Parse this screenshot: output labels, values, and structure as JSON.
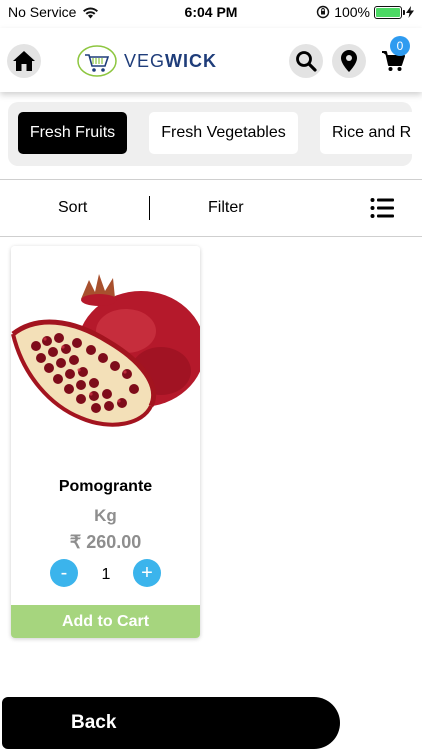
{
  "status_bar": {
    "carrier": "No Service",
    "time": "6:04 PM",
    "battery": "100%"
  },
  "header": {
    "logo_text_part1": "VEG",
    "logo_text_part2": "WICK",
    "cart_count": "0",
    "icons": [
      "home-icon",
      "search-icon",
      "location-icon",
      "cart-icon"
    ]
  },
  "categories": [
    {
      "label": "Fresh Fruits",
      "active": true
    },
    {
      "label": "Fresh Vegetables",
      "active": false
    },
    {
      "label": "Rice and Ri",
      "active": false
    }
  ],
  "toolbar": {
    "sort_label": "Sort",
    "filter_label": "Filter"
  },
  "product": {
    "name": "Pomogrante",
    "unit": "Kg",
    "price": "₹ 260.00",
    "quantity": "1",
    "minus_label": "-",
    "plus_label": "+",
    "add_to_cart_label": "Add to Cart"
  },
  "footer": {
    "back_label": "Back"
  },
  "colors": {
    "accent_blue": "#3bb4ec",
    "badge_blue": "#2e9bf0",
    "add_to_cart_green": "#a6d57e",
    "active_category": "#000000",
    "brand_navy": "#1f3d7a"
  }
}
